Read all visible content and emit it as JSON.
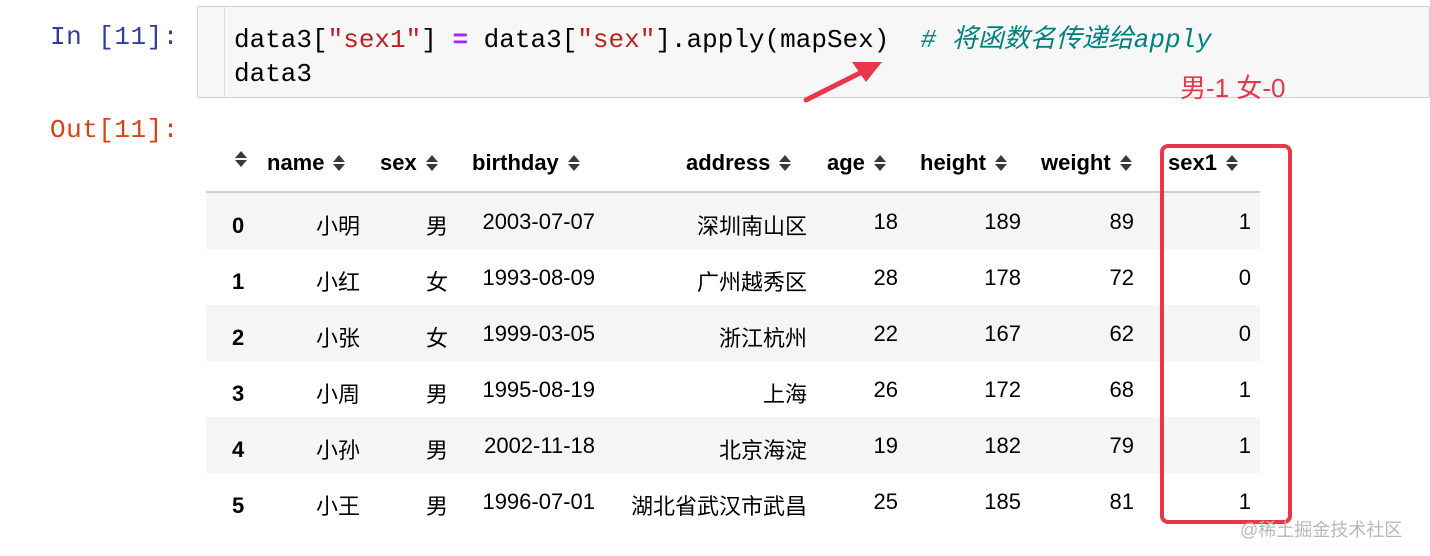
{
  "prompts": {
    "input": "In [11]:",
    "output": "Out[11]:"
  },
  "code": {
    "line1": [
      {
        "text": "data3[",
        "cls": ""
      },
      {
        "text": "\"sex1\"",
        "cls": "tok-str"
      },
      {
        "text": "] ",
        "cls": ""
      },
      {
        "text": "=",
        "cls": "tok-op"
      },
      {
        "text": " data3[",
        "cls": ""
      },
      {
        "text": "\"sex\"",
        "cls": "tok-str"
      },
      {
        "text": "].apply(mapSex)  ",
        "cls": ""
      },
      {
        "text": "# 将函数名传递给apply",
        "cls": "tok-comment"
      }
    ],
    "line2": "data3"
  },
  "annotation": {
    "text": "男-1 女-0",
    "color": "#e8374a"
  },
  "table": {
    "index_header": "",
    "columns": [
      "name",
      "sex",
      "birthday",
      "address",
      "age",
      "height",
      "weight",
      "sex1"
    ],
    "rows": [
      {
        "index": "0",
        "cells": [
          "小明",
          "男",
          "2003-07-07",
          "深圳南山区",
          "18",
          "189",
          "89",
          "1"
        ]
      },
      {
        "index": "1",
        "cells": [
          "小红",
          "女",
          "1993-08-09",
          "广州越秀区",
          "28",
          "178",
          "72",
          "0"
        ]
      },
      {
        "index": "2",
        "cells": [
          "小张",
          "女",
          "1999-03-05",
          "浙江杭州",
          "22",
          "167",
          "62",
          "0"
        ]
      },
      {
        "index": "3",
        "cells": [
          "小周",
          "男",
          "1995-08-19",
          "上海",
          "26",
          "172",
          "68",
          "1"
        ]
      },
      {
        "index": "4",
        "cells": [
          "小孙",
          "男",
          "2002-11-18",
          "北京海淀",
          "19",
          "182",
          "79",
          "1"
        ]
      },
      {
        "index": "5",
        "cells": [
          "小王",
          "男",
          "1996-07-01",
          "湖北省武汉市武昌",
          "25",
          "185",
          "81",
          "1"
        ]
      }
    ]
  },
  "watermark": "@稀土掘金技术社区",
  "colors": {
    "input_prompt": "#303f9f",
    "output_prompt": "#d84315",
    "highlight": "#e8374a"
  }
}
